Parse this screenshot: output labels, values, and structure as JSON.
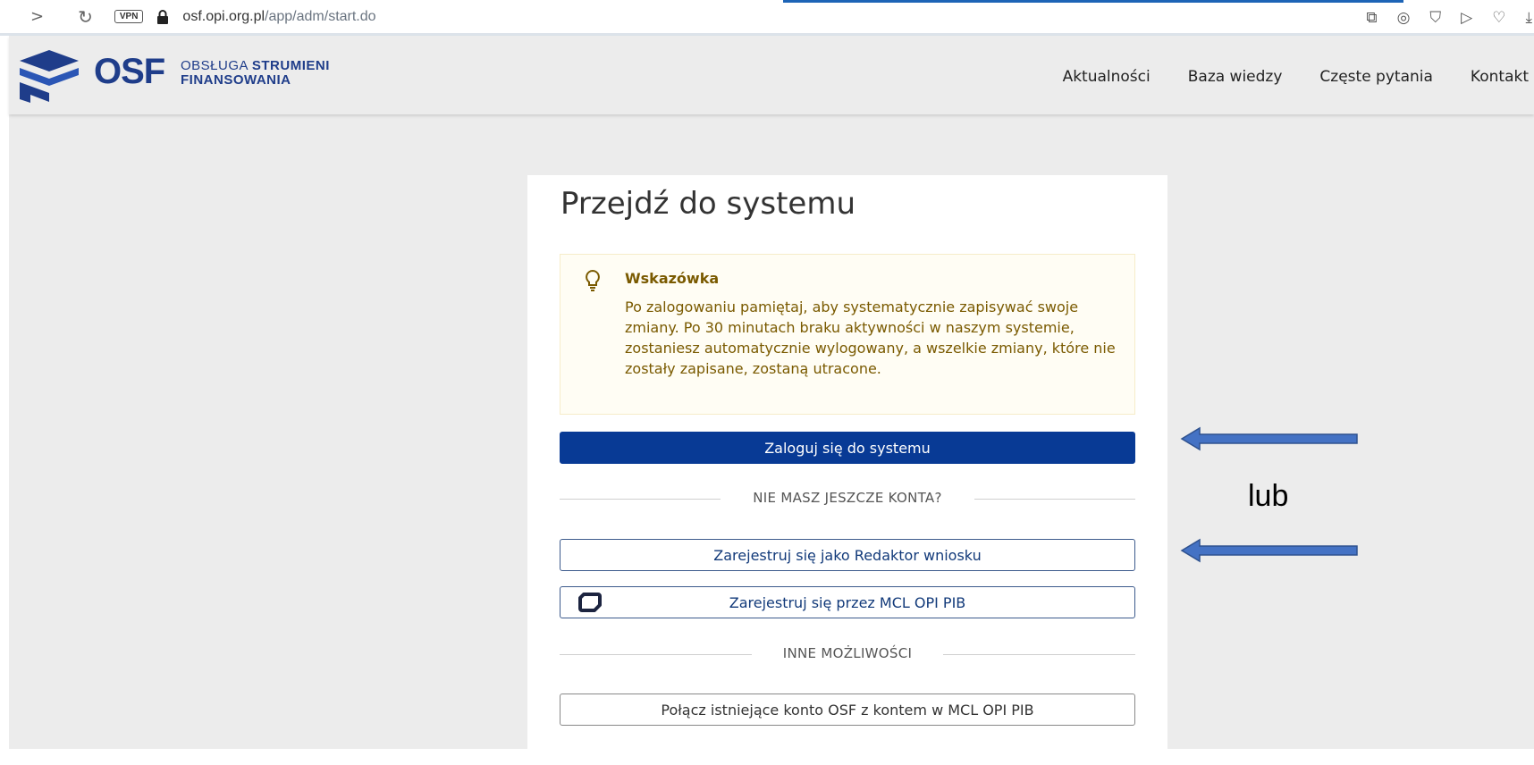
{
  "browser": {
    "vpn_label": "VPN",
    "url_host": "osf.opi.org.pl",
    "url_path": "/app/adm/start.do",
    "icons": [
      "back-icon",
      "reload-icon",
      "lock-icon",
      "share-icon",
      "camera-icon",
      "shield-icon",
      "send-icon",
      "heart-icon",
      "download-icon"
    ]
  },
  "header": {
    "logo_text": "OSF",
    "logo_sub_line1_a": "OBSŁUGA ",
    "logo_sub_line1_b": "STRUMIENI",
    "logo_sub_line2": "FINANSOWANIA",
    "nav": [
      "Aktualności",
      "Baza wiedzy",
      "Częste pytania",
      "Kontakt"
    ]
  },
  "card": {
    "title": "Przejdź do systemu",
    "hint": {
      "title": "Wskazówka",
      "text": "Po zalogowaniu pamiętaj, aby systematycznie zapisywać swoje zmiany. Po 30 minutach braku aktywności w naszym systemie, zostaniesz automatycznie wylogowany, a wszelkie zmiany, które nie zostały zapisane, zostaną utracone."
    },
    "login_button": "Zaloguj się do systemu",
    "divider_no_account": "NIE MASZ JESZCZE KONTA?",
    "register_editor_button": "Zarejestruj się jako Redaktor wniosku",
    "register_mcl_button": "Zarejestruj się przez MCL OPI PIB",
    "divider_other": "INNE MOŻLIWOŚCI",
    "link_account_button": "Połącz istniejące konto OSF z kontem w MCL OPI PIB"
  },
  "annotation": {
    "or_label": "lub",
    "arrow_color": "#4472c4"
  },
  "colors": {
    "primary": "#083a95",
    "brand": "#1f3d8a",
    "hint_text": "#7a5a00"
  }
}
